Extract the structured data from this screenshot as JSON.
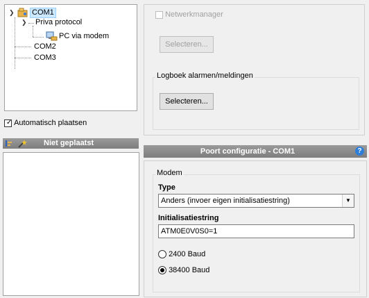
{
  "tree": {
    "items": [
      {
        "label": "COM1"
      },
      {
        "label": "Priva protocol"
      },
      {
        "label": "PC via modem"
      },
      {
        "label": "COM2"
      },
      {
        "label": "COM3"
      }
    ]
  },
  "auto_place": {
    "label": "Automatisch plaatsen",
    "checked": true
  },
  "unplaced": {
    "header": "Niet geplaatst"
  },
  "top_right": {
    "network_manager": {
      "label": "Netwerkmanager",
      "checked": false
    },
    "select_disabled": "Selecteren...",
    "log_group": {
      "title": "Logboek alarmen/meldingen",
      "button": "Selecteren..."
    }
  },
  "port_config": {
    "header": "Poort configuratie - COM1",
    "help_icon": "?",
    "modem_group": "Modem",
    "type_label": "Type",
    "type_value": "Anders (invoer eigen initialisatiestring)",
    "init_label": "Initialisatiestring",
    "init_value": "ATM0E0V0S0=1",
    "baud_options": [
      {
        "label": "2400 Baud",
        "selected": false
      },
      {
        "label": "38400 Baud",
        "selected": true
      }
    ]
  },
  "icons": [
    "chevron-down-icon",
    "modem-folder-icon",
    "protocol-icon",
    "pc-modem-icon",
    "placement-tool-icon",
    "wand-icon",
    "help-icon",
    "dropdown-arrow-icon"
  ],
  "colors": {
    "header_bg": "#8c8c8c",
    "selection": "#cce8ff",
    "help_blue": "#2f7fd8"
  }
}
